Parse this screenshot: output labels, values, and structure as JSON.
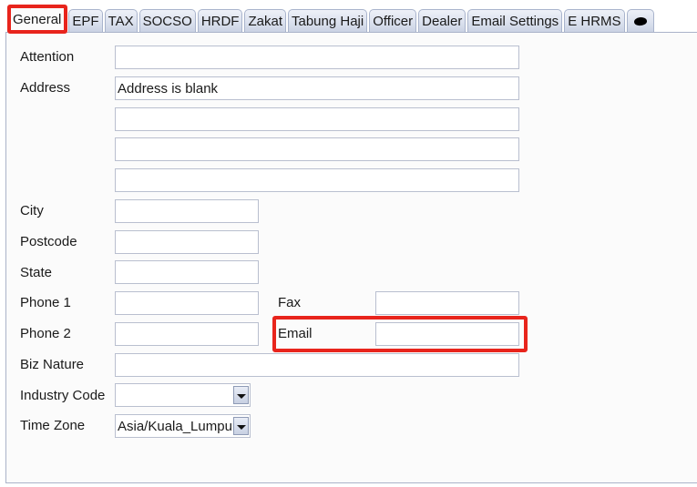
{
  "tabs": [
    {
      "label": "General",
      "active": true
    },
    {
      "label": "EPF"
    },
    {
      "label": "TAX"
    },
    {
      "label": "SOCSO"
    },
    {
      "label": "HRDF"
    },
    {
      "label": "Zakat"
    },
    {
      "label": "Tabung Haji"
    },
    {
      "label": "Officer"
    },
    {
      "label": "Dealer"
    },
    {
      "label": "Email Settings"
    },
    {
      "label": "E HRMS"
    },
    {
      "label": "",
      "icon": "cloud-icon"
    }
  ],
  "form": {
    "attention": {
      "label": "Attention",
      "value": ""
    },
    "address": {
      "label": "Address",
      "lines": [
        "Address is blank",
        "",
        "",
        ""
      ]
    },
    "city": {
      "label": "City",
      "value": ""
    },
    "postcode": {
      "label": "Postcode",
      "value": ""
    },
    "state": {
      "label": "State",
      "value": ""
    },
    "phone1": {
      "label": "Phone 1",
      "value": ""
    },
    "phone2": {
      "label": "Phone 2",
      "value": ""
    },
    "fax": {
      "label": "Fax",
      "value": ""
    },
    "email": {
      "label": "Email",
      "value": ""
    },
    "biz_nature": {
      "label": "Biz Nature",
      "value": ""
    },
    "industry_code": {
      "label": "Industry Code",
      "value": ""
    },
    "time_zone": {
      "label": "Time Zone",
      "value": "Asia/Kuala_Lumpur"
    }
  },
  "highlight_color": "#e8241c"
}
